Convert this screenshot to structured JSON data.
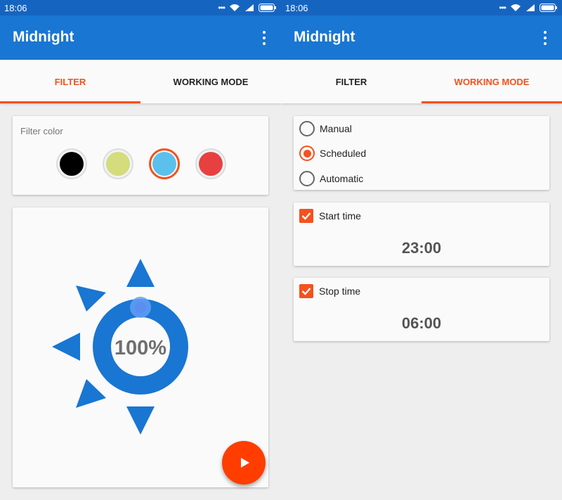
{
  "status": {
    "time": "18:06"
  },
  "app": {
    "title": "Midnight"
  },
  "tabs": [
    {
      "label": "FILTER"
    },
    {
      "label": "WORKING MODE"
    }
  ],
  "filter": {
    "label": "Filter color",
    "swatches": [
      {
        "color": "#000000"
      },
      {
        "color": "#d4dc7c"
      },
      {
        "color": "#5bc0eb",
        "selected": true
      },
      {
        "color": "#e84040"
      }
    ],
    "intensity": "100%",
    "intensity_value": 100,
    "accent": "#1976d2"
  },
  "mode": {
    "options": [
      {
        "label": "Manual"
      },
      {
        "label": "Scheduled",
        "selected": true
      },
      {
        "label": "Automatic"
      }
    ],
    "start": {
      "label": "Start time",
      "checked": true,
      "time": "23:00"
    },
    "stop": {
      "label": "Stop time",
      "checked": true,
      "time": "06:00"
    }
  },
  "colors": {
    "primary": "#1976d2",
    "status_bar": "#1565c0",
    "accent": "#f4511e",
    "fab": "#ff3d00"
  },
  "icons": {
    "overflow": "more-vert-icon",
    "fab": "play-icon",
    "wifi": "wifi-icon",
    "signal": "signal-icon",
    "battery": "battery-icon"
  }
}
